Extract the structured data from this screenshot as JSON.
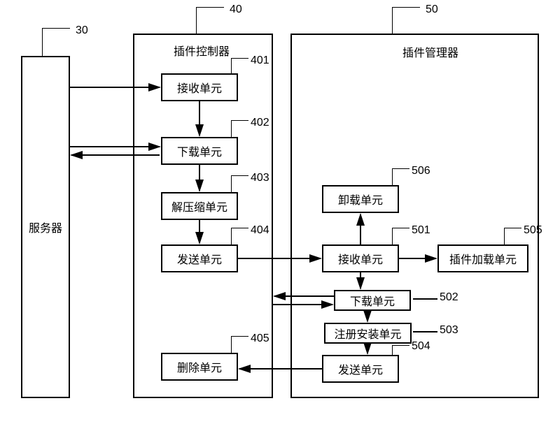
{
  "server": {
    "label": "服务器",
    "num": "30"
  },
  "controller": {
    "title": "插件控制器",
    "num": "40",
    "units": {
      "recv": {
        "label": "接收单元",
        "num": "401"
      },
      "dl": {
        "label": "下载单元",
        "num": "402"
      },
      "unzip": {
        "label": "解压缩单元",
        "num": "403"
      },
      "send": {
        "label": "发送单元",
        "num": "404"
      },
      "del": {
        "label": "删除单元",
        "num": "405"
      }
    }
  },
  "manager": {
    "title": "插件管理器",
    "num": "50",
    "units": {
      "unload": {
        "label": "卸载单元",
        "num": "506"
      },
      "recv": {
        "label": "接收单元",
        "num": "501"
      },
      "load": {
        "label": "插件加载单元",
        "num": "505"
      },
      "dl": {
        "label": "下载单元",
        "num": "502"
      },
      "reg": {
        "label": "注册安装单元",
        "num": "503"
      },
      "send": {
        "label": "发送单元",
        "num": "504"
      }
    }
  }
}
